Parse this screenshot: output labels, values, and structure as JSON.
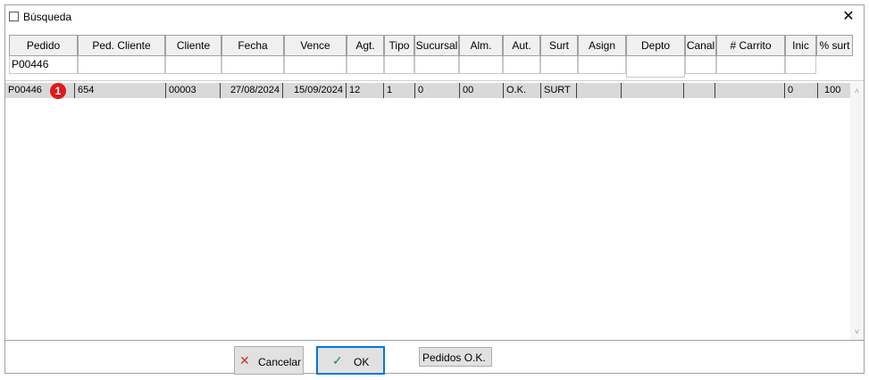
{
  "window": {
    "title": "Búsqueda",
    "close_glyph": "✕"
  },
  "columns": [
    "Pedido",
    "Ped. Cliente",
    "Cliente",
    "Fecha",
    "Vence",
    "Agt.",
    "Tipo",
    "Sucursal",
    "Alm.",
    "Aut.",
    "Surt",
    "Asign",
    "Depto",
    "Canal",
    "# Carrito",
    "Inic",
    "% surt"
  ],
  "filters": {
    "pedido": "P00446"
  },
  "rows": [
    {
      "pedido": "P00446",
      "ped_cliente": "654",
      "cliente": "00003",
      "fecha": "27/08/2024",
      "vence": "15/09/2024",
      "agt": "12",
      "tipo": "1",
      "sucursal": "0",
      "alm": "00",
      "aut": "O.K.",
      "surt": "SURT",
      "asign": "",
      "depto": "",
      "canal": "",
      "carrito": "",
      "inic": "0",
      "pct_surt": "100",
      "badge": "1"
    }
  ],
  "scroll": {
    "up_glyph": "˄",
    "down_glyph": "˅"
  },
  "buttons": {
    "cancel": {
      "label": "Cancelar",
      "icon": "close-icon",
      "glyph": "✕",
      "color": "#d32f2f"
    },
    "ok": {
      "label": "OK",
      "icon": "checkmark-icon",
      "glyph": "✓",
      "color": "#1e8e3e"
    },
    "pedidos_ok": {
      "label": "Pedidos O.K."
    }
  },
  "colors": {
    "selected_row": "#d9d9d9",
    "badge": "#e0191b",
    "focus_border": "#0078d7"
  }
}
